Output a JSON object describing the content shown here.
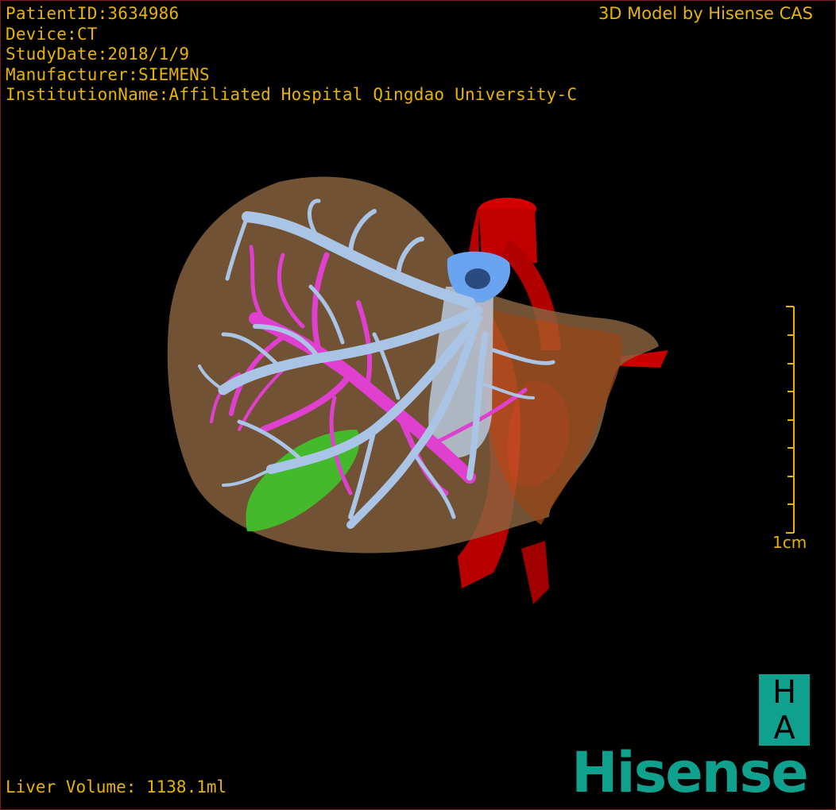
{
  "header": {
    "patient_id": "PatientID:3634986",
    "device": "Device:CT",
    "study_date": "StudyDate:2018/1/9",
    "manufacturer": "Manufacturer:SIEMENS",
    "institution": "InstitutionName:Affiliated Hospital Qingdao University-C"
  },
  "brand_top": "3D Model by Hisense CAS",
  "footer": {
    "liver_volume": "Liver Volume: 1138.1ml"
  },
  "scale": {
    "label": "1cm"
  },
  "logo": {
    "letter_top": "H",
    "letter_bottom": "A",
    "wordmark": "Hisense"
  },
  "colors": {
    "text": "#e8b400",
    "brand": "#0fa08e",
    "liver": "#8a6440",
    "hepatic_vein": "#a9c4e4",
    "portal_vein": "#e040d0",
    "ivc_top": "#6aa4f0",
    "aorta": "#c40000",
    "gallbladder": "#3fc22a"
  }
}
